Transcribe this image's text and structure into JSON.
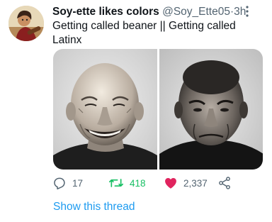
{
  "tweet": {
    "display_name": "Soy-ette likes colors",
    "handle": "@Soy_Ette05",
    "separator": "·",
    "time": "3h",
    "text_line1": "Getting called beaner || Getting called",
    "text_line2": "Latinx"
  },
  "photos": [
    {
      "description_icon": "smiling-bald-man-photo"
    },
    {
      "description_icon": "frowning-bald-man-photo"
    }
  ],
  "actions": {
    "reply_count": "17",
    "retweet_count": "418",
    "like_count": "2,337"
  },
  "show_thread_label": "Show this thread",
  "colors": {
    "retweet": "#17bf63",
    "like": "#e0245e",
    "link": "#1d9bf0",
    "secondary_text": "#536471"
  }
}
